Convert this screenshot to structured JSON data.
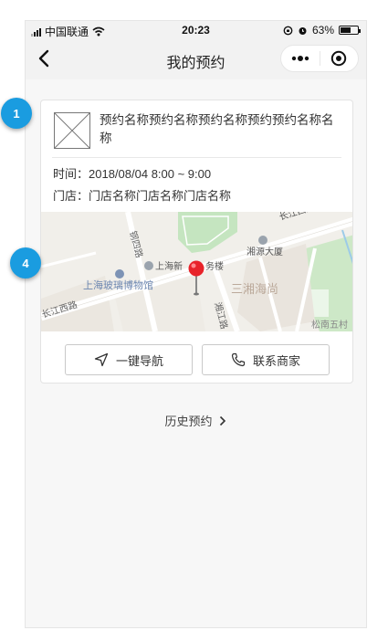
{
  "status_bar": {
    "carrier": "中国联通",
    "time": "20:23",
    "battery": "63%",
    "battery_level": 0.63
  },
  "nav": {
    "title": "我的预约",
    "menu_icon": "more-dots-icon",
    "close_icon": "target-circle-icon"
  },
  "card": {
    "name": "预约名称预约名称预约名称预约预约名称名称",
    "time_label": "时间：",
    "time_value": "2018/08/04 8:00 ~ 9:00",
    "store_label": "门店：",
    "store_value": "门店名称门店名称门店名称",
    "map_labels": [
      "钢四路",
      "长江西路",
      "湘源大厦",
      "上海新",
      "务楼",
      "上海玻璃博物馆",
      "三湘海尚",
      "长江西路",
      "湘江路",
      "松南五村"
    ],
    "nav_button": "一键导航",
    "contact_button": "联系商家"
  },
  "history_link": "历史预约",
  "annotations": [
    "1",
    "4"
  ],
  "colors": {
    "badge": "#1a9ce0",
    "pin": "#e8232a",
    "map_green": "#c5e5c0"
  }
}
